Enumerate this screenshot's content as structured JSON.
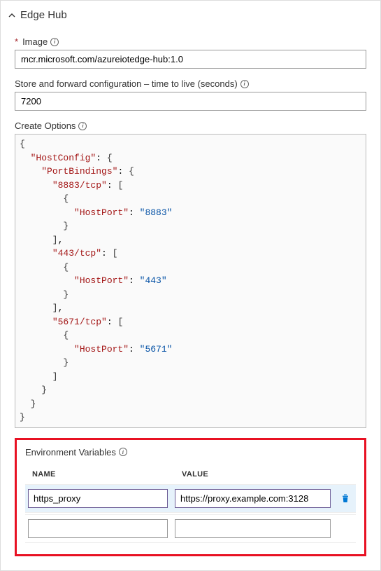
{
  "section": {
    "title": "Edge Hub"
  },
  "image": {
    "label": "Image",
    "value": "mcr.microsoft.com/azureiotedge-hub:1.0",
    "required": true
  },
  "ttl": {
    "label": "Store and forward configuration – time to live (seconds)",
    "value": "7200"
  },
  "createOptions": {
    "label": "Create Options",
    "json": {
      "HostConfig": {
        "PortBindings": {
          "8883/tcp": [
            {
              "HostPort": "8883"
            }
          ],
          "443/tcp": [
            {
              "HostPort": "443"
            }
          ],
          "5671/tcp": [
            {
              "HostPort": "5671"
            }
          ]
        }
      }
    }
  },
  "envVars": {
    "label": "Environment Variables",
    "columns": {
      "name": "NAME",
      "value": "VALUE"
    },
    "rows": [
      {
        "name": "https_proxy",
        "value": "https://proxy.example.com:3128",
        "selected": true
      },
      {
        "name": "",
        "value": "",
        "selected": false
      }
    ]
  }
}
